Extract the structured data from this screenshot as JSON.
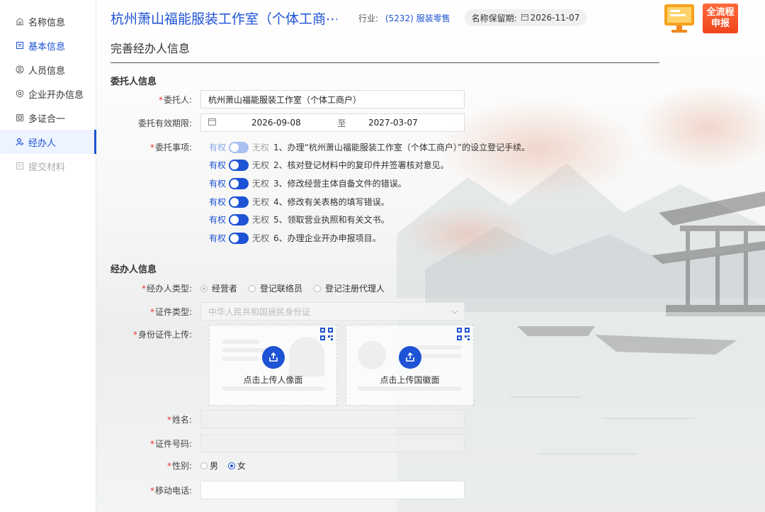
{
  "sidebar": {
    "items": [
      {
        "label": "名称信息",
        "icon": "building-icon"
      },
      {
        "label": "基本信息",
        "icon": "document-icon"
      },
      {
        "label": "人员信息",
        "icon": "person-icon"
      },
      {
        "label": "企业开办信息",
        "icon": "badge-icon"
      },
      {
        "label": "多证合一",
        "icon": "cards-icon"
      },
      {
        "label": "经办人",
        "icon": "agent-icon"
      },
      {
        "label": "提交材料",
        "icon": "upload-doc-icon"
      }
    ]
  },
  "header": {
    "company_name": "杭州萧山福能服装工作室（个体工商⋯",
    "industry_label": "行业:",
    "industry_value": "(5232) 服装零售",
    "reserve_label": "名称保留期:",
    "reserve_date": "2026-11-07"
  },
  "promo": {
    "line1": "全流程",
    "line2": "申报"
  },
  "page_heading": "完善经办人信息",
  "principal_section": {
    "title": "委托人信息",
    "principal_label": "委托人:",
    "principal_value": "杭州萧山福能服装工作室（个体工商户）",
    "validity_label": "委托有效期限:",
    "validity_start": "2026-09-08",
    "validity_sep": "至",
    "validity_end": "2027-03-07",
    "matters_label": "委托事项:",
    "yes_label": "有权",
    "no_label": "无权",
    "matters": [
      "1、办理“杭州萧山福能服装工作室（个体工商户）”的设立登记手续。",
      "2、核对登记材料中的复印件并签署核对意见。",
      "3、修改经营主体自备文件的错误。",
      "4、修改有关表格的填写错误。",
      "5、领取营业执照和有关文书。",
      "6、办理企业开办申报项目。"
    ]
  },
  "agent_section": {
    "title": "经办人信息",
    "type_label": "经办人类型:",
    "type_options": [
      "经营者",
      "登记联络员",
      "登记注册代理人"
    ],
    "id_type_label": "证件类型:",
    "id_type_value": "中华人民共和国居民身份证",
    "upload_label": "身份证件上传:",
    "upload_front": "点击上传人像面",
    "upload_back": "点击上传国徽面",
    "name_label": "姓名:",
    "id_number_label": "证件号码:",
    "gender_label": "性别:",
    "gender_options": [
      "男",
      "女"
    ],
    "phone_label": "移动电话:"
  }
}
